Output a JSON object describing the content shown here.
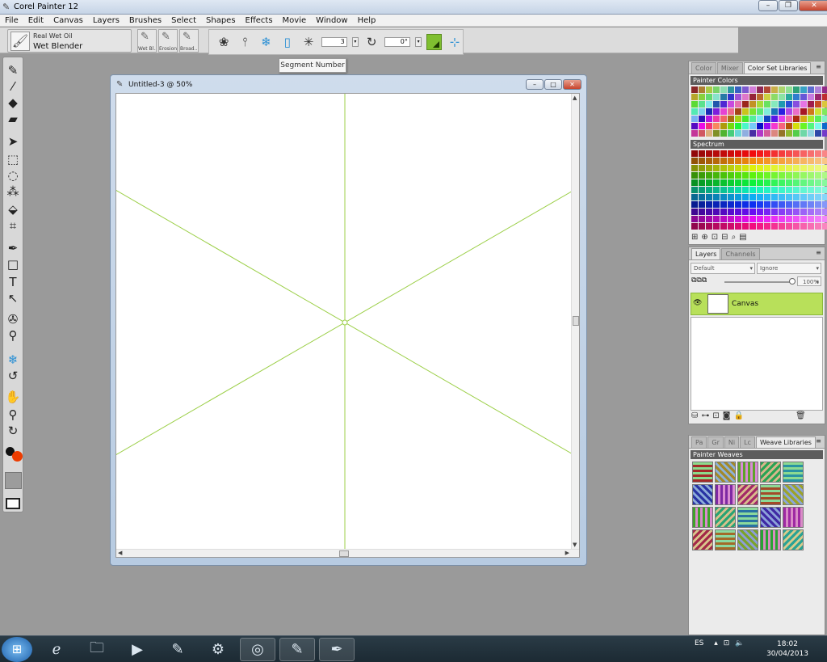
{
  "window": {
    "title": "Corel Painter 12",
    "icon": "brush-app-icon"
  },
  "menu": [
    "File",
    "Edit",
    "Canvas",
    "Layers",
    "Brushes",
    "Select",
    "Shapes",
    "Effects",
    "Movie",
    "Window",
    "Help"
  ],
  "brush_selector": {
    "category": "Real Wet Oil",
    "variant": "Wet Blender"
  },
  "recent_brushes": [
    {
      "label": "Wet Bl..."
    },
    {
      "label": "Erosion..."
    },
    {
      "label": "Broad..."
    }
  ],
  "kaleidoscope_bar": {
    "segment_value": "3",
    "angle_value": "0°"
  },
  "tooltip": "Segment Number",
  "document": {
    "title": "Untitled-3 @ 50%",
    "guide_color": "#9ccf48",
    "segments": 3
  },
  "color_panel": {
    "tabs": [
      "Color",
      "Mixer",
      "Color Set Libraries"
    ],
    "section1": "Painter Colors",
    "section2": "Spectrum"
  },
  "layers_panel": {
    "tabs": [
      "Layers",
      "Channels"
    ],
    "composite_method": "Default",
    "composite_depth": "Ignore",
    "opacity": "100%",
    "layer_name": "Canvas"
  },
  "weave_panel": {
    "tabs": [
      "Pa",
      "Gr",
      "Ni",
      "Lc",
      "Weave Libraries"
    ],
    "section": "Painter Weaves"
  },
  "taskbar": {
    "lang": "ES",
    "time": "18:02",
    "date": "30/04/2013"
  },
  "colors": {
    "accent_green": "#b8e05a",
    "primary_color": "#ec3c00",
    "secondary_color": "#111111"
  }
}
